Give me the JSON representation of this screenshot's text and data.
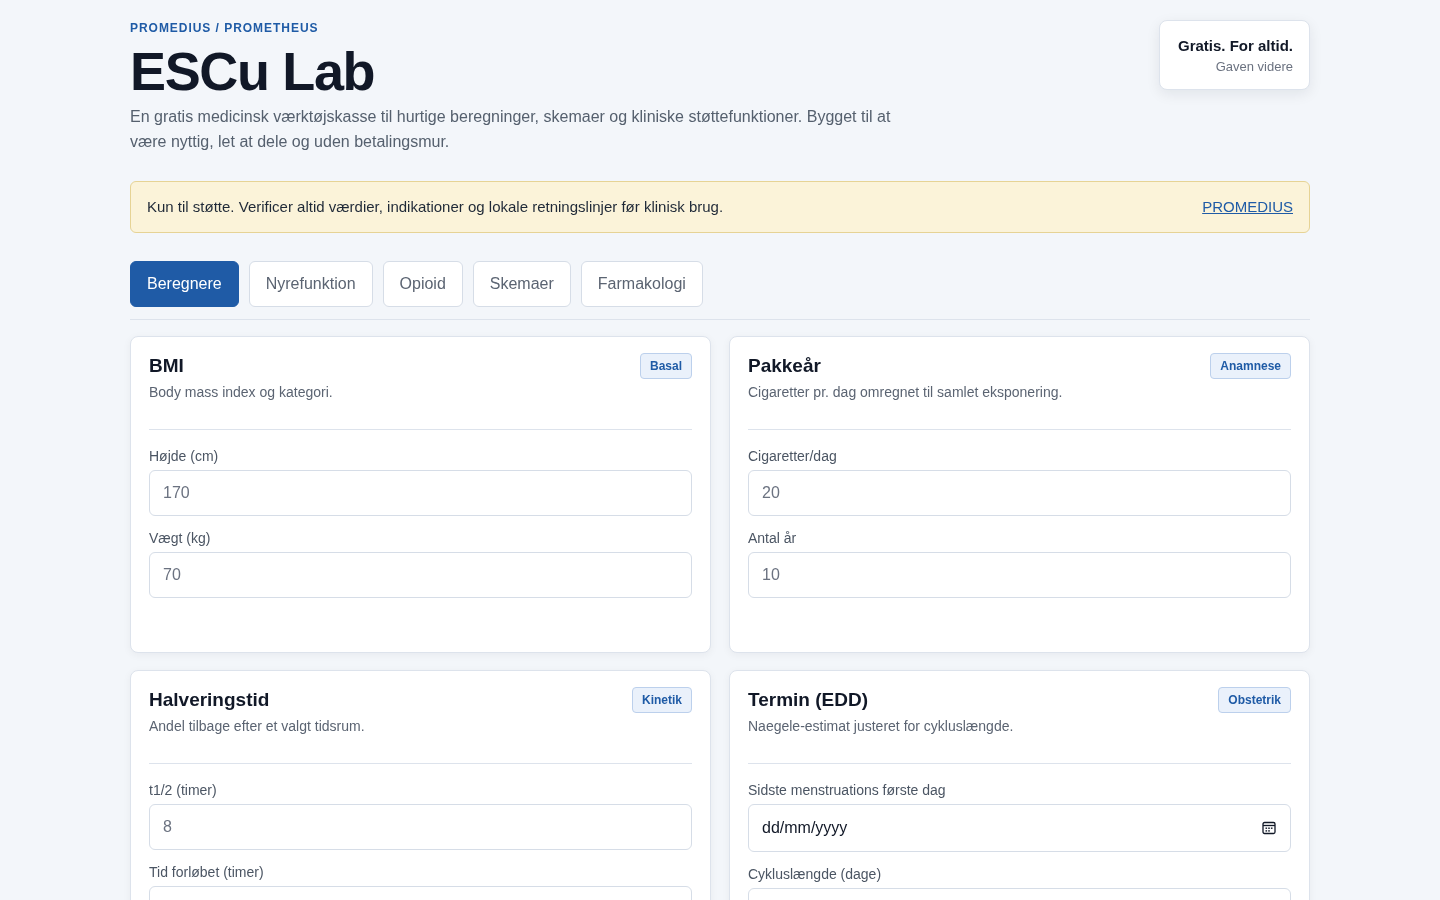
{
  "header": {
    "eyebrow": "PROMEDIUS / PROMETHEUS",
    "title": "ESCu Lab",
    "description": "En gratis medicinsk værktøjskasse til hurtige beregninger, skemaer og kliniske støttefunktioner. Bygget til at være nyttig, let at dele og uden betalingsmur."
  },
  "promo": {
    "title": "Gratis. For altid.",
    "subtitle": "Gaven videre"
  },
  "notice": {
    "text": "Kun til støtte. Verificer altid værdier, indikationer og lokale retningslinjer før klinisk brug.",
    "link": "PROMEDIUS"
  },
  "tabs": [
    {
      "label": "Beregnere",
      "selected": true
    },
    {
      "label": "Nyrefunktion",
      "selected": false
    },
    {
      "label": "Opioid",
      "selected": false
    },
    {
      "label": "Skemaer",
      "selected": false
    },
    {
      "label": "Farmakologi",
      "selected": false
    }
  ],
  "cards": [
    {
      "title": "BMI",
      "description": "Body mass index og kategori.",
      "tag": "Basal",
      "fields": [
        {
          "kind": "number",
          "label": "Højde (cm)",
          "placeholder": "170"
        },
        {
          "kind": "number",
          "label": "Vægt (kg)",
          "placeholder": "70"
        }
      ]
    },
    {
      "title": "Pakkeår",
      "description": "Cigaretter pr. dag omregnet til samlet eksponering.",
      "tag": "Anamnese",
      "fields": [
        {
          "kind": "number",
          "label": "Cigaretter/dag",
          "placeholder": "20"
        },
        {
          "kind": "number",
          "label": "Antal år",
          "placeholder": "10"
        }
      ]
    },
    {
      "title": "Halveringstid",
      "description": "Andel tilbage efter et valgt tidsrum.",
      "tag": "Kinetik",
      "fields": [
        {
          "kind": "number",
          "label": "t1/2 (timer)",
          "placeholder": "8"
        },
        {
          "kind": "number",
          "label": "Tid forløbet (timer)"
        }
      ]
    },
    {
      "title": "Termin (EDD)",
      "description": "Naegele-estimat justeret for cykluslængde.",
      "tag": "Obstetrik",
      "fields": [
        {
          "kind": "date",
          "label": "Sidste menstruations første dag",
          "placeholder": "dd/mm/yyyy"
        },
        {
          "kind": "number",
          "label": "Cykluslængde (dage)"
        }
      ]
    }
  ]
}
